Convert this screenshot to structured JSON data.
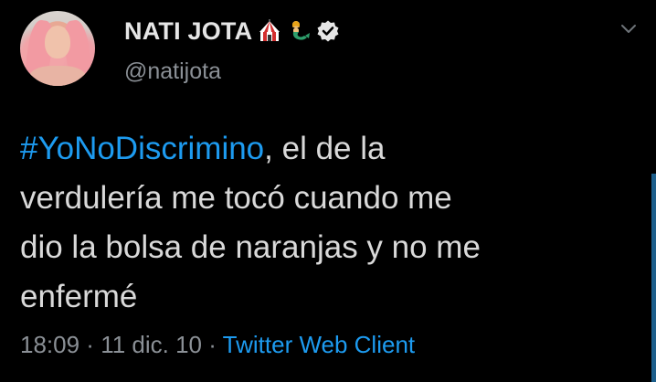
{
  "user": {
    "display_name": "NATI JOTA",
    "handle": "@natijota",
    "verified": true,
    "emojis": [
      "circus-tent-icon",
      "mermaid-icon"
    ]
  },
  "tweet": {
    "hashtag": "#YoNoDiscrimino",
    "line1_rest": ", el de la",
    "line2": "verdulería me tocó cuando me",
    "line3": "dio la bolsa de naranjas y no me",
    "line4": "enfermé"
  },
  "meta": {
    "time": "18:09",
    "sep1": " · ",
    "date": "11 dic. 10",
    "sep2": " · ",
    "source": "Twitter Web Client"
  },
  "colors": {
    "background": "#000000",
    "link": "#1d9bf0",
    "muted": "#8b9096"
  }
}
